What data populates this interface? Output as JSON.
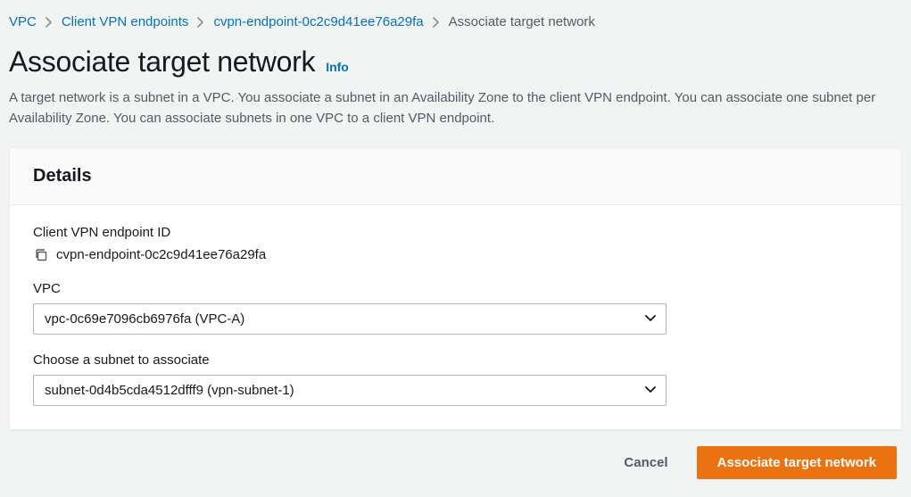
{
  "breadcrumb": {
    "vpc": "VPC",
    "endpoints": "Client VPN endpoints",
    "endpoint_id": "cvpn-endpoint-0c2c9d41ee76a29fa",
    "current": "Associate target network"
  },
  "header": {
    "title": "Associate target network",
    "info": "Info",
    "description": "A target network is a subnet in a VPC. You associate a subnet in an Availability Zone to the client VPN endpoint. You can associate one subnet per Availability Zone. You can associate subnets in one VPC to a client VPN endpoint."
  },
  "panel": {
    "title": "Details",
    "endpoint_label": "Client VPN endpoint ID",
    "endpoint_value": "cvpn-endpoint-0c2c9d41ee76a29fa",
    "vpc_label": "VPC",
    "vpc_value": "vpc-0c69e7096cb6976fa (VPC-A)",
    "subnet_label": "Choose a subnet to associate",
    "subnet_value": "subnet-0d4b5cda4512dfff9 (vpn-subnet-1)"
  },
  "footer": {
    "cancel": "Cancel",
    "submit": "Associate target network"
  }
}
